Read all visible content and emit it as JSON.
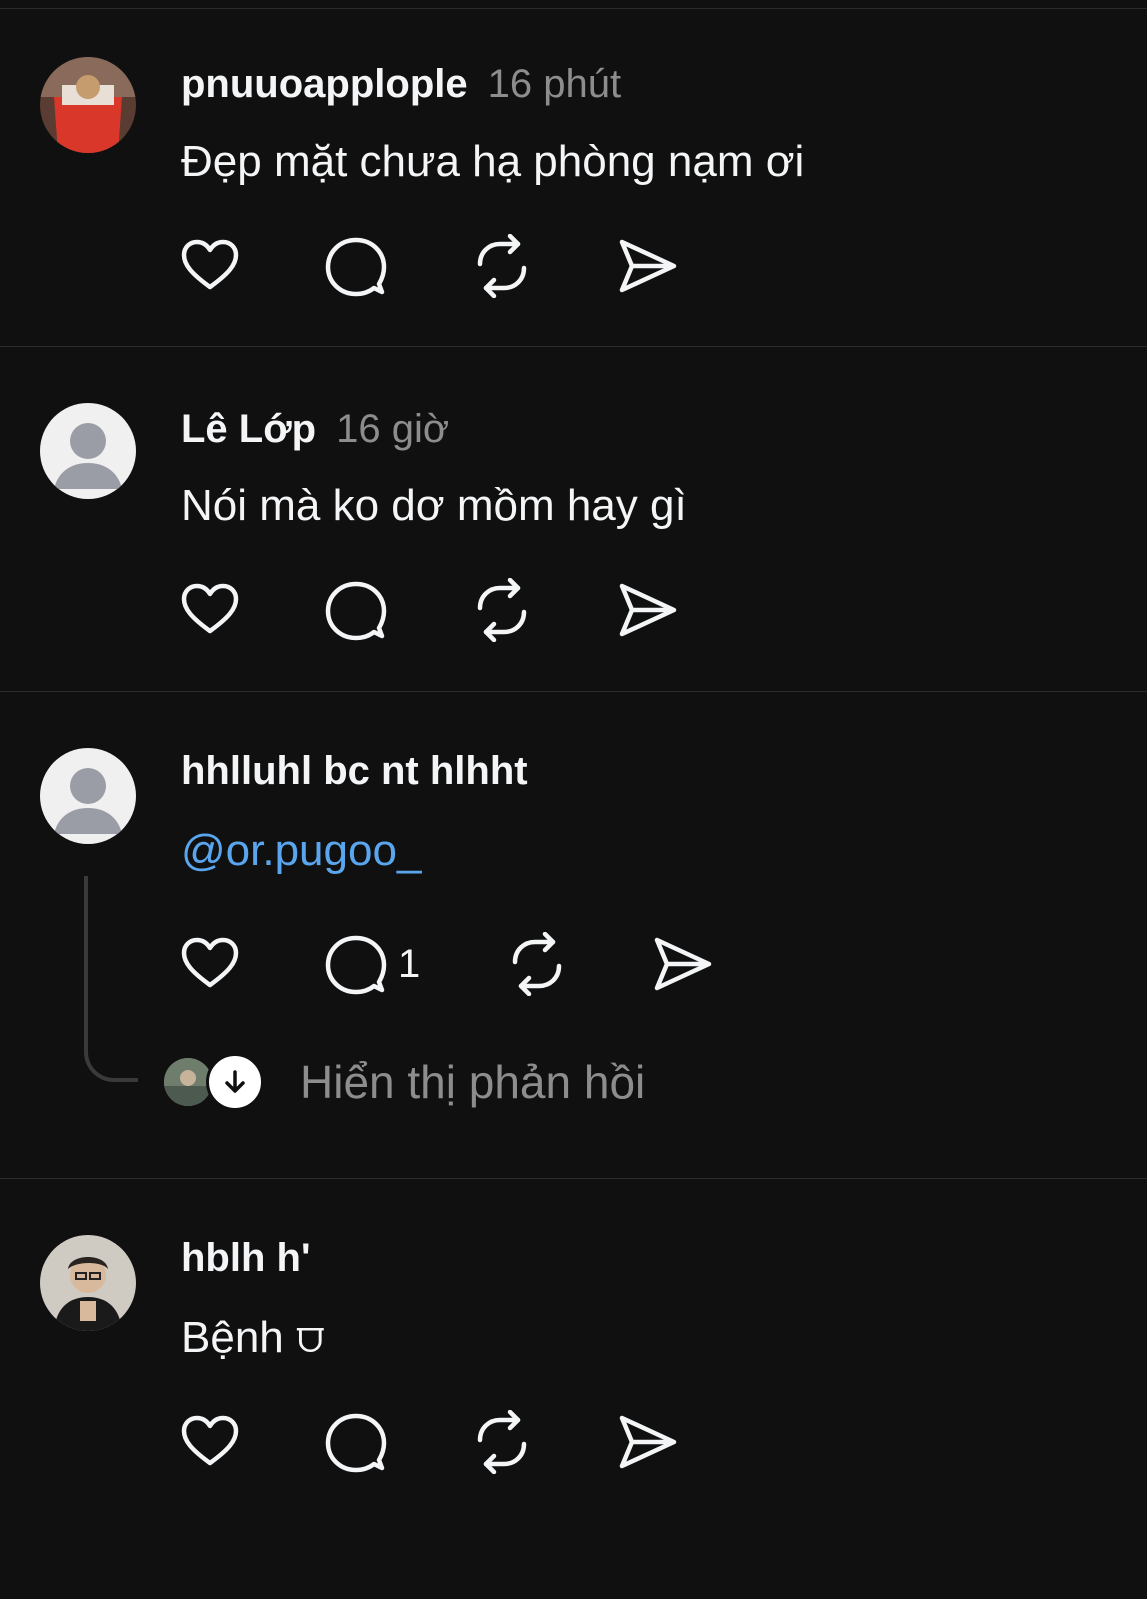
{
  "posts": [
    {
      "username": "pnuuoapplople",
      "timestamp": "16 phút",
      "content": "Đẹp mặt chưa hạ phòng nạm ơi",
      "avatar": "photo-avatar-red",
      "actions": {
        "like": "heart-icon",
        "comment": "comment-icon",
        "repost": "repost-icon",
        "share": "send-icon"
      }
    },
    {
      "username": "Lê Lớp",
      "timestamp": "16 giờ",
      "content": "Nói mà ko dơ mồm hay gì",
      "avatar": "default-avatar",
      "actions": {
        "like": "heart-icon",
        "comment": "comment-icon",
        "repost": "repost-icon",
        "share": "send-icon"
      }
    },
    {
      "username": "hhlluhl bc nt hlhht",
      "timestamp": "",
      "mention": "@or.pugoo_",
      "comment_count": "1",
      "show_replies_label": "Hiển thị phản hồi",
      "avatar": "default-avatar",
      "actions": {
        "like": "heart-icon",
        "comment": "comment-icon",
        "repost": "repost-icon",
        "share": "send-icon"
      }
    },
    {
      "username": "hblh h'",
      "timestamp": "",
      "content": "Bệnh ⩌",
      "avatar": "photo-avatar-person",
      "actions": {
        "like": "heart-icon",
        "comment": "comment-icon",
        "repost": "repost-icon",
        "share": "send-icon"
      }
    }
  ],
  "colors": {
    "background": "#101010",
    "text": "#f3f5f7",
    "secondary_text": "#8d8d8d",
    "mention": "#5aa6ee",
    "divider": "#2c2c2c"
  }
}
